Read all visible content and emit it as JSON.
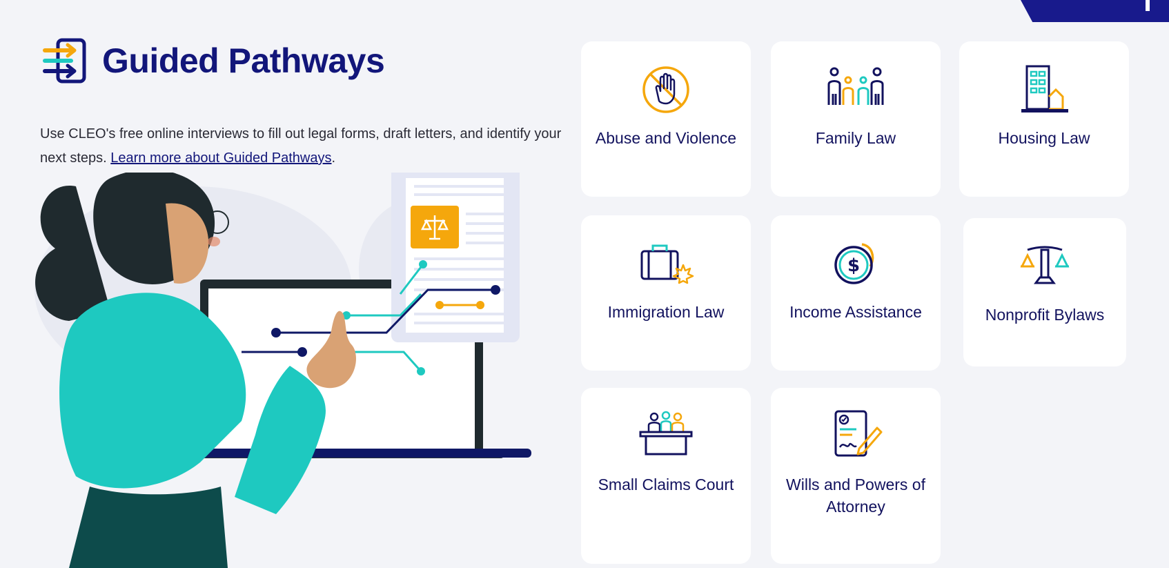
{
  "header": {
    "title": "Guided Pathways",
    "intro_text": "Use CLEO's free online interviews to fill out legal forms, draft letters, and identify your next steps.",
    "intro_link": "Learn more about Guided Pathways",
    "intro_end": "."
  },
  "cards": [
    {
      "label": "Abuse and Violence",
      "icon": "hand-stop-icon"
    },
    {
      "label": "Family Law",
      "icon": "family-icon"
    },
    {
      "label": "Housing Law",
      "icon": "building-house-icon"
    },
    {
      "label": "Immigration Law",
      "icon": "suitcase-maple-leaf-icon"
    },
    {
      "label": "Income Assistance",
      "icon": "dollar-coin-icon"
    },
    {
      "label": "Nonprofit Bylaws",
      "icon": "scales-icon"
    },
    {
      "label": "Small Claims Court",
      "icon": "court-podium-icon"
    },
    {
      "label": "Wills and Powers of Attorney",
      "icon": "signed-document-icon"
    }
  ],
  "colors": {
    "navy": "#12167a",
    "orange": "#f5a70c",
    "teal": "#1ec9c0",
    "background": "#f3f4f8"
  }
}
